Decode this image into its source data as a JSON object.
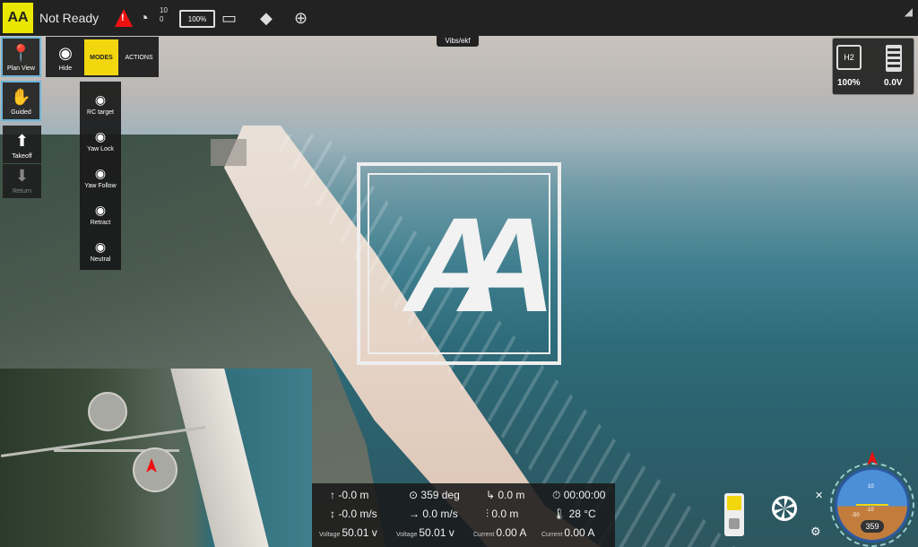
{
  "topbar": {
    "logo_text": "AA",
    "status": "Not Ready",
    "sat_count": "10",
    "sat_hdop": "0",
    "battery_label": "100%"
  },
  "ekf_label": "Vibs/ekf",
  "left_buttons": {
    "plan_view": "Plan View",
    "guided": "Guided",
    "takeoff": "Takeoff",
    "return": "Return"
  },
  "mode_bar": {
    "hide": "Hide",
    "modes": "MODES",
    "actions": "ACTIONS"
  },
  "mode_items": [
    {
      "label": "RC target"
    },
    {
      "label": "Yaw Lock"
    },
    {
      "label": "Yaw Follow"
    },
    {
      "label": "Retract"
    },
    {
      "label": "Neutral"
    }
  ],
  "right_panel": {
    "h2_icon": "H2",
    "h2_percent": "100%",
    "battery_voltage": "0.0V"
  },
  "center_logo": "AA",
  "telemetry": {
    "altitude": "-0.0 m",
    "heading": "359 deg",
    "distance": "0.0 m",
    "time": "00:00:00",
    "vertical_speed": "-0.0 m/s",
    "ground_speed": "0.0 m/s",
    "dist2": "0.0 m",
    "temperature": "28 °C",
    "voltage1_label": "Voltage",
    "voltage1": "50.01 v",
    "voltage2_label": "Voltage",
    "voltage2": "50.01 v",
    "current1_label": "Current",
    "current1": "0.00 A",
    "current2_label": "Current",
    "current2": "0.00 A"
  },
  "attitude": {
    "heading_value": "359",
    "tick_10": "10",
    "tick_neg10": "-10",
    "tick_neg50": "-50"
  }
}
